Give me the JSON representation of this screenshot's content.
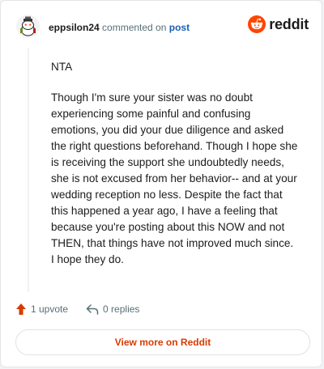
{
  "header": {
    "username": "eppsilon24",
    "commented_on": "commented on",
    "post_link": "post"
  },
  "brand": {
    "wordmark": "reddit",
    "logo_icon": "reddit-snoo-icon",
    "color": "#ff4500"
  },
  "comment": {
    "paragraphs": [
      "NTA",
      "Though I'm sure your sister was no doubt experiencing some painful and confusing emotions, you did your due diligence and asked the right questions beforehand. Though I hope she is receiving the support she undoubtedly needs, she is not excused from her behavior-- and at your wedding reception no less. Despite the fact that this happened a year ago, I have a feeling that because you're posting about this NOW and not THEN, that things have not improved much since. I hope they do."
    ]
  },
  "actions": {
    "upvotes": "1 upvote",
    "replies": "0 replies"
  },
  "footer": {
    "view_more": "View more on Reddit"
  },
  "colors": {
    "accent": "#d93a00",
    "upvote": "#d93a00",
    "link": "#1a5fb4"
  }
}
